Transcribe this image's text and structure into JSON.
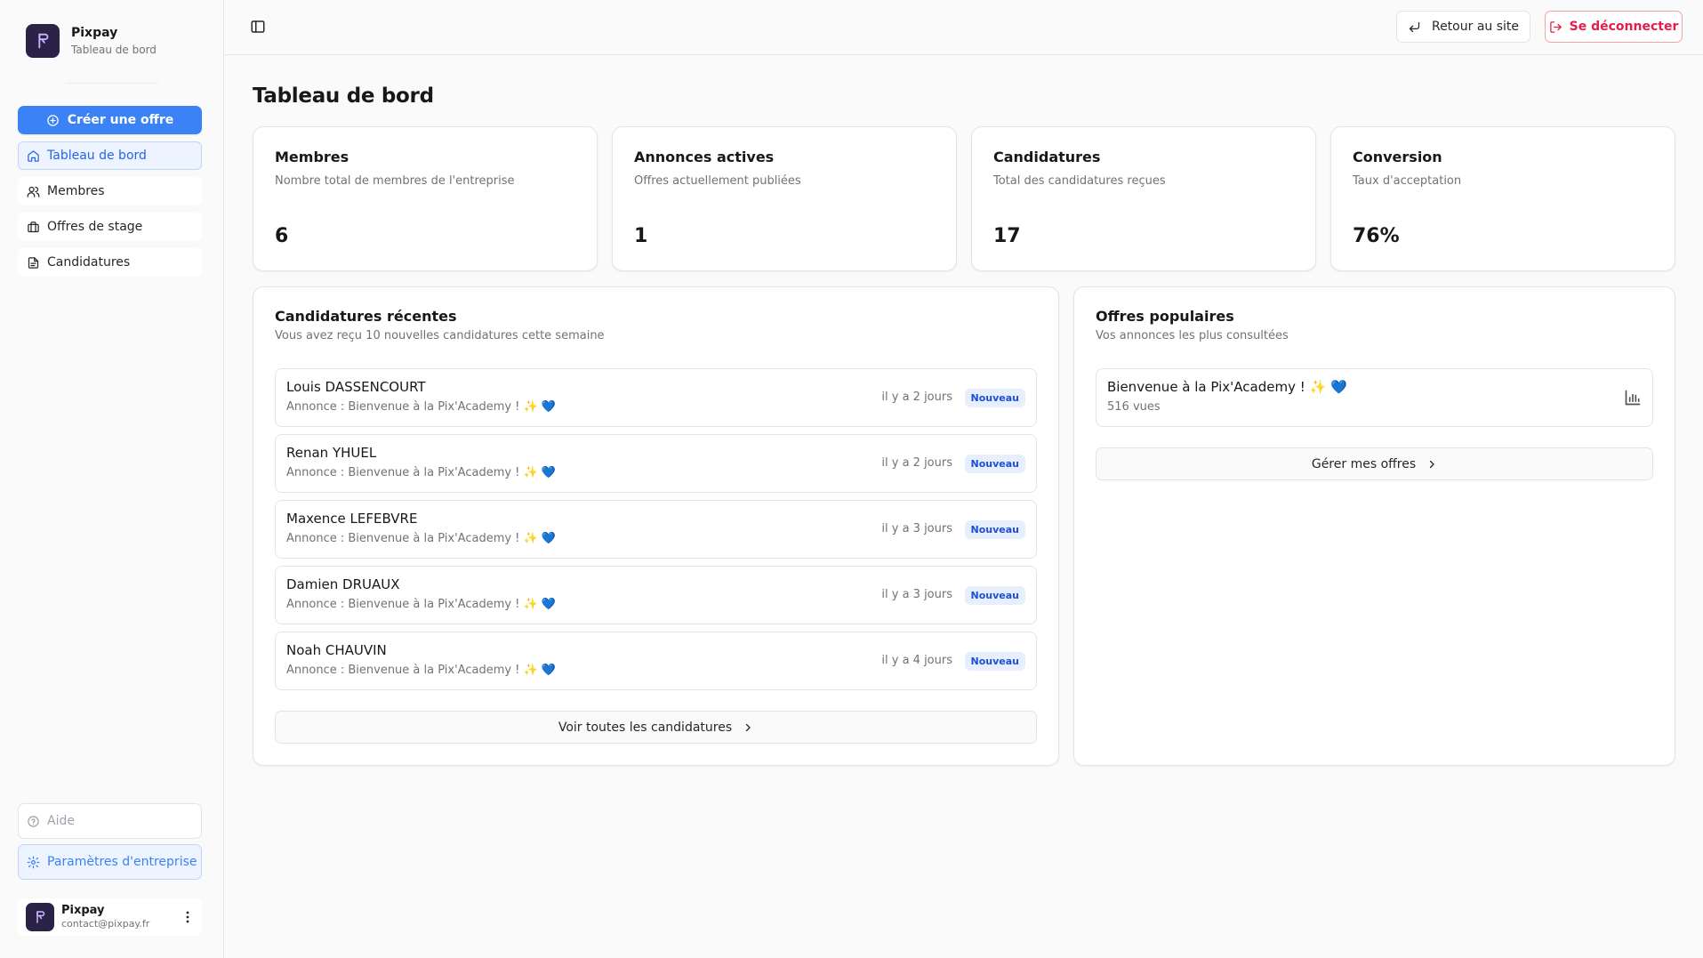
{
  "brand": {
    "name": "Pixpay",
    "subtitle": "Tableau de bord"
  },
  "sidebar": {
    "create_label": "Créer une offre",
    "items": [
      {
        "label": "Tableau de bord",
        "icon": "home-icon",
        "active": true
      },
      {
        "label": "Membres",
        "icon": "users-icon",
        "active": false
      },
      {
        "label": "Offres de stage",
        "icon": "briefcase-icon",
        "active": false
      },
      {
        "label": "Candidatures",
        "icon": "file-text-icon",
        "active": false
      }
    ],
    "help_label": "Aide",
    "settings_label": "Paramètres d'entreprise"
  },
  "user": {
    "name": "Pixpay",
    "email": "contact@pixpay.fr"
  },
  "topbar": {
    "back_label": "Retour au site",
    "logout_label": "Se déconnecter"
  },
  "page": {
    "title": "Tableau de bord"
  },
  "stats": [
    {
      "title": "Membres",
      "desc": "Nombre total de membres de l'entreprise",
      "value": "6"
    },
    {
      "title": "Annonces actives",
      "desc": "Offres actuellement publiées",
      "value": "1"
    },
    {
      "title": "Candidatures",
      "desc": "Total des candidatures reçues",
      "value": "17"
    },
    {
      "title": "Conversion",
      "desc": "Taux d'acceptation",
      "value": "76%"
    }
  ],
  "recent": {
    "title": "Candidatures récentes",
    "desc": "Vous avez reçu 10 nouvelles candidatures cette semaine",
    "items": [
      {
        "name": "Louis DASSENCOURT",
        "offer": "Annonce : Bienvenue à la Pix'Academy ! ✨ 💙",
        "time": "il y a 2 jours",
        "badge": "Nouveau"
      },
      {
        "name": "Renan YHUEL",
        "offer": "Annonce : Bienvenue à la Pix'Academy ! ✨ 💙",
        "time": "il y a 2 jours",
        "badge": "Nouveau"
      },
      {
        "name": "Maxence LEFEBVRE",
        "offer": "Annonce : Bienvenue à la Pix'Academy ! ✨ 💙",
        "time": "il y a 3 jours",
        "badge": "Nouveau"
      },
      {
        "name": "Damien DRUAUX",
        "offer": "Annonce : Bienvenue à la Pix'Academy ! ✨ 💙",
        "time": "il y a 3 jours",
        "badge": "Nouveau"
      },
      {
        "name": "Noah CHAUVIN",
        "offer": "Annonce : Bienvenue à la Pix'Academy ! ✨ 💙",
        "time": "il y a 4 jours",
        "badge": "Nouveau"
      }
    ],
    "see_all_label": "Voir toutes les candidatures"
  },
  "popular": {
    "title": "Offres populaires",
    "desc": "Vos annonces les plus consultées",
    "items": [
      {
        "name": "Bienvenue à la Pix'Academy ! ✨ 💙",
        "views": "516 vues"
      }
    ],
    "manage_label": "Gérer mes offres"
  },
  "colors": {
    "accent": "#3b82f6",
    "danger": "#e11d48",
    "logo_bg": "#2a2247"
  }
}
